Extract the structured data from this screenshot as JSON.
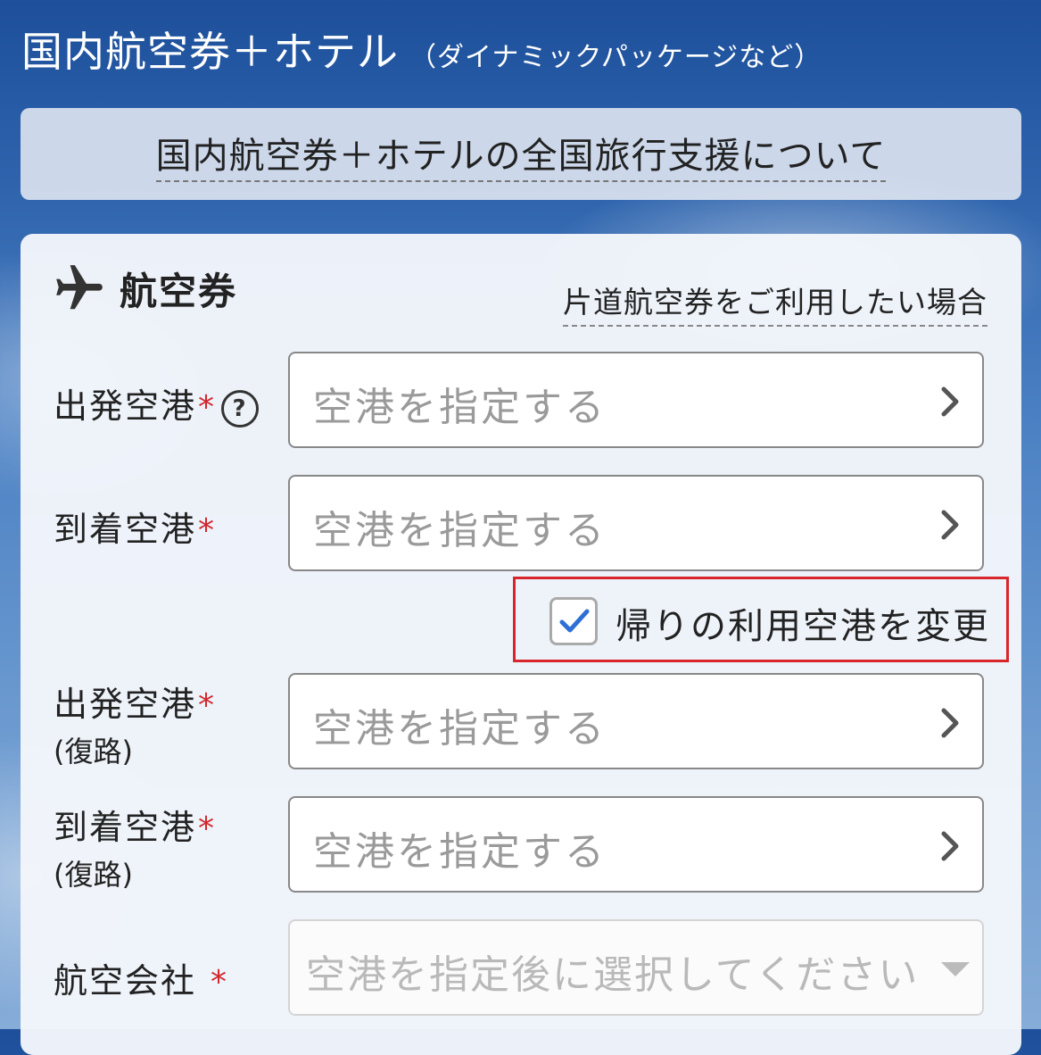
{
  "header": {
    "title": "国内航空券＋ホテル",
    "subtitle": "（ダイナミックパッケージなど）"
  },
  "banner": {
    "link_label": "国内航空券＋ホテルの全国旅行支援について"
  },
  "flight": {
    "section_title": "航空券",
    "section_icon": "airplane-icon",
    "oneway_link": "片道航空券をご利用したい場合",
    "fields": [
      {
        "label": "出発空港",
        "required_mark": "*",
        "placeholder": "空港を指定する"
      },
      {
        "label": "到着空港",
        "required_mark": "*",
        "placeholder": "空港を指定する"
      },
      {
        "label": "出発空港",
        "sublabel": "(復路)",
        "required_mark": "*",
        "placeholder": "空港を指定する"
      },
      {
        "label": "到着空港",
        "sublabel": "(復路)",
        "required_mark": "*",
        "placeholder": "空港を指定する"
      }
    ],
    "help_mark": "?",
    "return_toggle": {
      "label": "帰りの利用空港を変更",
      "checked": true
    },
    "airline": {
      "label": "航空会社",
      "required_mark": "*",
      "placeholder": "空港を指定後に選択してください"
    }
  },
  "colors": {
    "required": "#d2282e",
    "check": "#2e6fd6",
    "highlight_border": "#d8262c"
  }
}
